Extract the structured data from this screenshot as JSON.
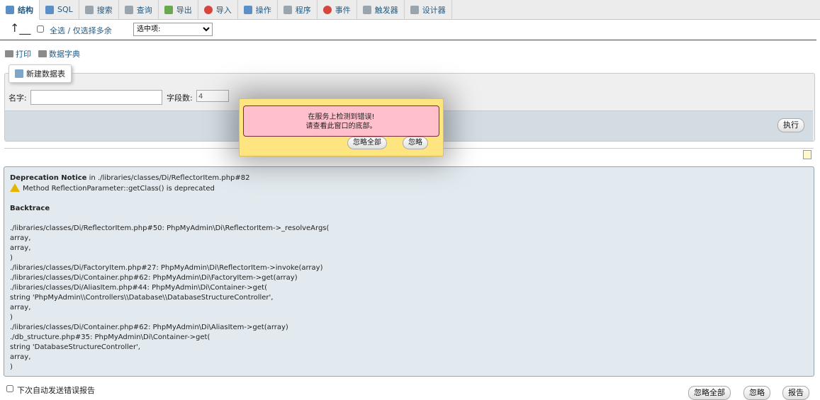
{
  "tabs": [
    {
      "label": "结构",
      "icon": "structure-icon",
      "active": true
    },
    {
      "label": "SQL",
      "icon": "sql-icon"
    },
    {
      "label": "搜索",
      "icon": "search-icon"
    },
    {
      "label": "查询",
      "icon": "query-icon"
    },
    {
      "label": "导出",
      "icon": "export-icon"
    },
    {
      "label": "导入",
      "icon": "import-icon"
    },
    {
      "label": "操作",
      "icon": "wrench-icon"
    },
    {
      "label": "程序",
      "icon": "routines-icon"
    },
    {
      "label": "事件",
      "icon": "clock-icon"
    },
    {
      "label": "触发器",
      "icon": "triggers-icon"
    },
    {
      "label": "设计器",
      "icon": "designer-icon"
    }
  ],
  "selection": {
    "check_all_label": "全选 / 仅选择多余",
    "with_selected_value": "选中项:"
  },
  "tools": {
    "print": "打印",
    "data_dict": "数据字典"
  },
  "create_table": {
    "legend": "新建数据表",
    "name_label": "名字:",
    "fields_label": "字段数:",
    "fields_value": "4",
    "execute": "执行"
  },
  "error_details": {
    "notice_title": "Deprecation Notice",
    "notice_location": " in ./libraries/classes/Di/ReflectorItem.php#82",
    "notice_message": "Method ReflectionParameter::getClass() is deprecated",
    "backtrace_title": "Backtrace",
    "backtrace": [
      "./libraries/classes/Di/ReflectorItem.php#50: PhpMyAdmin\\Di\\ReflectorItem->_resolveArgs(",
      "array,",
      "array,",
      ")",
      "./libraries/classes/Di/FactoryItem.php#27: PhpMyAdmin\\Di\\ReflectorItem->invoke(array)",
      "./libraries/classes/Di/Container.php#62: PhpMyAdmin\\Di\\FactoryItem->get(array)",
      "./libraries/classes/Di/AliasItem.php#44: PhpMyAdmin\\Di\\Container->get(",
      "string 'PhpMyAdmin\\\\Controllers\\\\Database\\\\DatabaseStructureController',",
      "array,",
      ")",
      "./libraries/classes/Di/Container.php#62: PhpMyAdmin\\Di\\AliasItem->get(array)",
      "./db_structure.php#35: PhpMyAdmin\\Di\\Container->get(",
      "string 'DatabaseStructureController',",
      "array,",
      ")"
    ]
  },
  "bottom": {
    "auto_send_label": "下次自动发送错误报告",
    "ignore_all": "忽略全部",
    "ignore": "忽略",
    "report": "报告"
  },
  "popup": {
    "line1": "在服务上检测到错误!",
    "line2": "请查看此窗口的底部。",
    "ignore_all": "忽略全部",
    "ignore": "忽略"
  }
}
